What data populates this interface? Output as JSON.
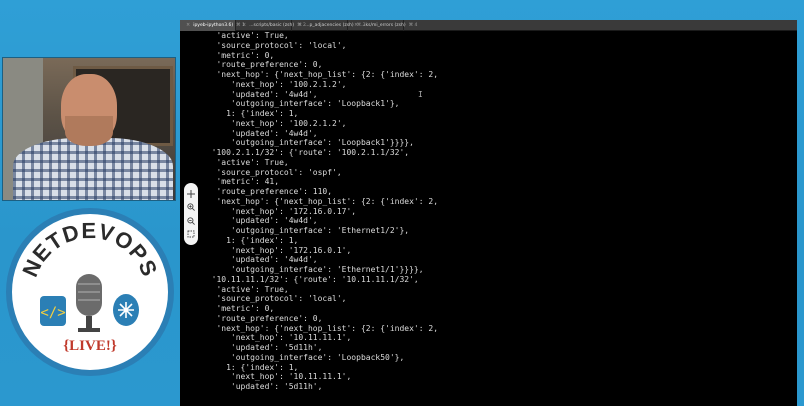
{
  "tabs": [
    {
      "label": "ipyeb-ipython3.6)",
      "key": "⌘ 1",
      "active": true
    },
    {
      "label": "...scripts/basic (zsh)",
      "key": "⌘ 2",
      "active": false
    },
    {
      "label": "...p_adjacencies (zsh)",
      "key": "⌘ 3",
      "active": false
    },
    {
      "label": "...ks/mi_errors (zsh)",
      "key": "⌘ 4",
      "active": false
    }
  ],
  "logo": {
    "top_text": "NETDEVOPS",
    "bottom_text": "{LIVE!}",
    "accent_color": "#2b7fb5",
    "mic_color": "#555555",
    "icons": [
      "code-brackets-icon",
      "microphone-icon",
      "network-router-icon"
    ]
  },
  "zoom_controls": [
    "pan-icon",
    "zoom-in-icon",
    "zoom-out-icon",
    "fit-icon"
  ],
  "terminal_lines": [
    "   'active': True,",
    "   'source_protocol': 'local',",
    "   'metric': 0,",
    "   'route_preference': 0,",
    "   'next_hop': {'next_hop_list': {2: {'index': 2,",
    "      'next_hop': '100.2.1.2',",
    "      'updated': '4w4d',",
    "      'outgoing_interface': 'Loopback1'},",
    "     1: {'index': 1,",
    "      'next_hop': '100.2.1.2',",
    "      'updated': '4w4d',",
    "      'outgoing_interface': 'Loopback1'}}}},",
    "  '100.2.1.1/32': {'route': '100.2.1.1/32',",
    "   'active': True,",
    "   'source_protocol': 'ospf',",
    "   'metric': 41,",
    "   'route_preference': 110,",
    "   'next_hop': {'next_hop_list': {2: {'index': 2,",
    "      'next_hop': '172.16.0.17',",
    "      'updated': '4w4d',",
    "      'outgoing_interface': 'Ethernet1/2'},",
    "     1: {'index': 1,",
    "      'next_hop': '172.16.0.1',",
    "      'updated': '4w4d',",
    "      'outgoing_interface': 'Ethernet1/1'}}}},",
    "  '10.11.11.1/32': {'route': '10.11.11.1/32',",
    "   'active': True,",
    "   'source_protocol': 'local',",
    "   'metric': 0,",
    "   'route_preference': 0,",
    "   'next_hop': {'next_hop_list': {2: {'index': 2,",
    "      'next_hop': '10.11.11.1',",
    "      'updated': '5d11h',",
    "      'outgoing_interface': 'Loopback50'},",
    "     1: {'index': 1,",
    "      'next_hop': '10.11.11.1',",
    "      'updated': '5d11h',"
  ],
  "cursor_glyph": "I"
}
